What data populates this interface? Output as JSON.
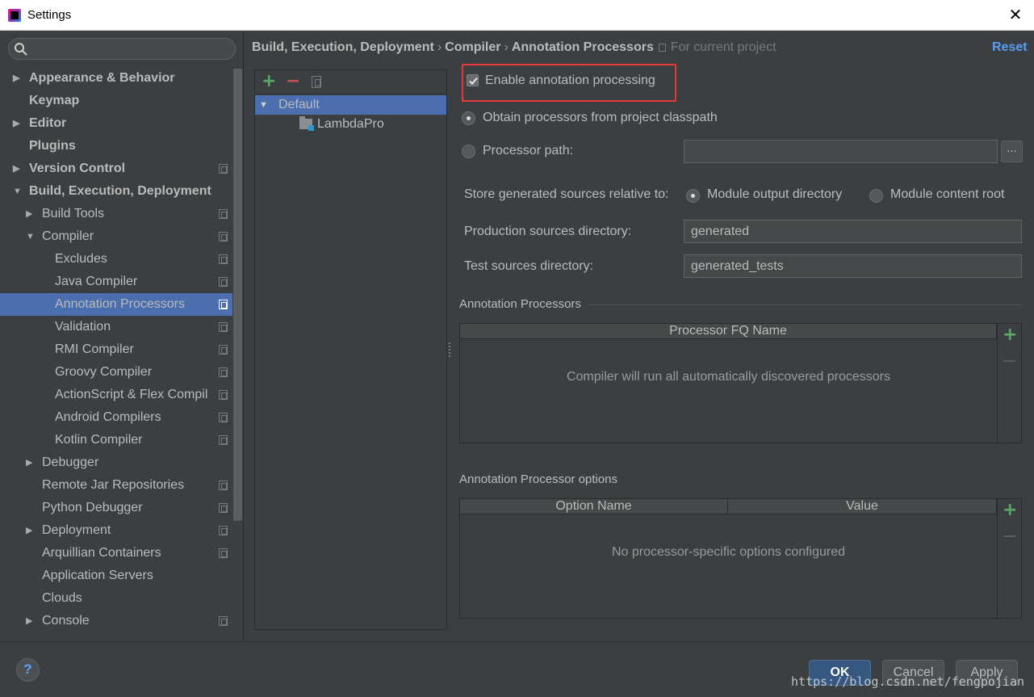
{
  "window": {
    "title": "Settings"
  },
  "search": {
    "placeholder": ""
  },
  "sidebar": {
    "items": [
      {
        "label": "Appearance & Behavior",
        "level": 0,
        "arrow": "collapsed",
        "bold": true,
        "copy": false
      },
      {
        "label": "Keymap",
        "level": 0,
        "arrow": "none",
        "bold": true,
        "copy": false
      },
      {
        "label": "Editor",
        "level": 0,
        "arrow": "collapsed",
        "bold": true,
        "copy": false
      },
      {
        "label": "Plugins",
        "level": 0,
        "arrow": "none",
        "bold": true,
        "copy": false
      },
      {
        "label": "Version Control",
        "level": 0,
        "arrow": "collapsed",
        "bold": true,
        "copy": true
      },
      {
        "label": "Build, Execution, Deployment",
        "level": 0,
        "arrow": "expanded",
        "bold": true,
        "copy": false
      },
      {
        "label": "Build Tools",
        "level": 1,
        "arrow": "collapsed",
        "bold": false,
        "copy": true
      },
      {
        "label": "Compiler",
        "level": 1,
        "arrow": "expanded",
        "bold": false,
        "copy": true
      },
      {
        "label": "Excludes",
        "level": 2,
        "arrow": "none",
        "bold": false,
        "copy": true
      },
      {
        "label": "Java Compiler",
        "level": 2,
        "arrow": "none",
        "bold": false,
        "copy": true
      },
      {
        "label": "Annotation Processors",
        "level": 2,
        "arrow": "none",
        "bold": false,
        "copy": true,
        "selected": true
      },
      {
        "label": "Validation",
        "level": 2,
        "arrow": "none",
        "bold": false,
        "copy": true
      },
      {
        "label": "RMI Compiler",
        "level": 2,
        "arrow": "none",
        "bold": false,
        "copy": true
      },
      {
        "label": "Groovy Compiler",
        "level": 2,
        "arrow": "none",
        "bold": false,
        "copy": true
      },
      {
        "label": "ActionScript & Flex Compil",
        "level": 2,
        "arrow": "none",
        "bold": false,
        "copy": true
      },
      {
        "label": "Android Compilers",
        "level": 2,
        "arrow": "none",
        "bold": false,
        "copy": true
      },
      {
        "label": "Kotlin Compiler",
        "level": 2,
        "arrow": "none",
        "bold": false,
        "copy": true
      },
      {
        "label": "Debugger",
        "level": 1,
        "arrow": "collapsed",
        "bold": false,
        "copy": false
      },
      {
        "label": "Remote Jar Repositories",
        "level": 1,
        "arrow": "none",
        "bold": false,
        "copy": true
      },
      {
        "label": "Python Debugger",
        "level": 1,
        "arrow": "none",
        "bold": false,
        "copy": true
      },
      {
        "label": "Deployment",
        "level": 1,
        "arrow": "collapsed",
        "bold": false,
        "copy": true
      },
      {
        "label": "Arquillian Containers",
        "level": 1,
        "arrow": "none",
        "bold": false,
        "copy": true
      },
      {
        "label": "Application Servers",
        "level": 1,
        "arrow": "none",
        "bold": false,
        "copy": false
      },
      {
        "label": "Clouds",
        "level": 1,
        "arrow": "none",
        "bold": false,
        "copy": false
      },
      {
        "label": "Console",
        "level": 1,
        "arrow": "collapsed",
        "bold": false,
        "copy": true
      }
    ]
  },
  "breadcrumb": {
    "parts": [
      "Build, Execution, Deployment",
      "Compiler",
      "Annotation Processors"
    ],
    "separator": "›",
    "scope": "For current project"
  },
  "reset_label": "Reset",
  "profiles": {
    "items": [
      {
        "label": "Default",
        "selected": true
      },
      {
        "label": "LambdaPro",
        "selected": false
      }
    ]
  },
  "settings": {
    "enable_annotation_processing": {
      "label": "Enable annotation processing",
      "checked": true
    },
    "obtain_from_classpath": {
      "label": "Obtain processors from project classpath",
      "selected": true
    },
    "processor_path": {
      "label": "Processor path:",
      "selected": false,
      "value": ""
    },
    "browse_label": "...",
    "store_generated": {
      "label": "Store generated sources relative to:",
      "option_module_output": "Module output directory",
      "option_content_root": "Module content root",
      "selected": "Module output directory"
    },
    "production_dir": {
      "label": "Production sources directory:",
      "value": "generated"
    },
    "test_dir": {
      "label": "Test sources directory:",
      "value": "generated_tests"
    }
  },
  "processors_section": {
    "title": "Annotation Processors",
    "column": "Processor FQ Name",
    "empty_text": "Compiler will run all automatically discovered processors"
  },
  "options_section": {
    "title": "Annotation Processor options",
    "columns": [
      "Option Name",
      "Value"
    ],
    "empty_text": "No processor-specific options configured"
  },
  "footer": {
    "help_label": "?",
    "ok_label": "OK",
    "cancel_label": "Cancel",
    "apply_label": "Apply",
    "watermark": "https://blog.csdn.net/fengpojian"
  },
  "colors": {
    "accent": "#4b6eaf",
    "link": "#589df6",
    "add_green": "#59a869",
    "remove_red": "#c75450",
    "highlight_red": "#e53935"
  }
}
